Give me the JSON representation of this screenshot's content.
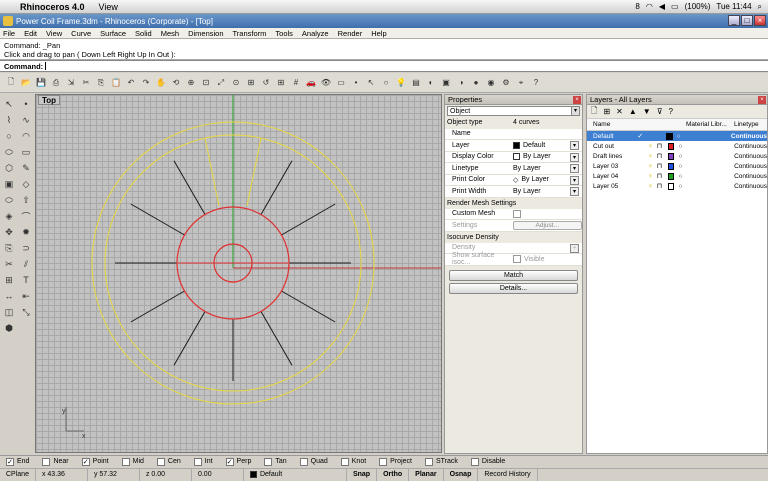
{
  "macbar": {
    "app": "Rhinoceros 4.0",
    "view_menu": "View",
    "flag": "8",
    "battery": "(100%)",
    "time": "Tue 11:44"
  },
  "window": {
    "title": "Power Coil Frame.3dm - Rhinoceros (Corporate) - [Top]"
  },
  "menu": [
    "File",
    "Edit",
    "View",
    "Curve",
    "Surface",
    "Solid",
    "Mesh",
    "Dimension",
    "Transform",
    "Tools",
    "Analyze",
    "Render",
    "Help"
  ],
  "command": {
    "history": [
      "Command: _Pan",
      "Click and drag to pan ( Down  Left  Right  Up  In  Out ):"
    ],
    "prompt": "Command:"
  },
  "toolbar_icons": [
    "new-icon",
    "open-icon",
    "save-icon",
    "print-icon",
    "import-icon",
    "cut-icon",
    "copy-icon",
    "paste-icon",
    "undo-icon",
    "redo-icon",
    "pan-icon",
    "rotate-view-icon",
    "zoom-dynamic-icon",
    "zoom-window-icon",
    "zoom-extents-icon",
    "zoom-selected-icon",
    "zoom-extents-all-icon",
    "undo-view-icon",
    "four-viewports-icon",
    "grid-snap-icon",
    "car-icon",
    "eye-icon",
    "plane-icon",
    "point-icon",
    "select-icon",
    "circle-icon",
    "light-icon",
    "layer-icon",
    "render-icon",
    "hide-icon",
    "shade-icon",
    "rendered-icon",
    "sphere-icon",
    "properties-icon",
    "osnap-icon",
    "help-icon"
  ],
  "left_tools": [
    "select-arrow-icon",
    "point-tool-icon",
    "polyline-icon",
    "curve-icon",
    "circle-tool-icon",
    "arc-icon",
    "ellipse-icon",
    "rectangle-icon",
    "polygon-icon",
    "freeform-icon",
    "box-icon",
    "surface-icon",
    "cylinder-icon",
    "extrude-icon",
    "boolean-icon",
    "fillet-icon",
    "move-icon",
    "explode-icon",
    "copy-tool-icon",
    "join-icon",
    "trim-icon",
    "split-icon",
    "array-icon",
    "text-icon",
    "dimension-icon",
    "align-icon",
    "mirror-icon",
    "scale-icon",
    "solid-icon"
  ],
  "viewport": {
    "label": "Top",
    "axis_x": "x",
    "axis_y": "y"
  },
  "properties": {
    "header": "Properties",
    "dropdown": "Object",
    "object_type_label": "Object type",
    "object_type_value": "4 curves",
    "rows": [
      {
        "k": "Name",
        "v": ""
      },
      {
        "k": "Layer",
        "v": "Default"
      },
      {
        "k": "Display Color",
        "v": "By Layer"
      },
      {
        "k": "Linetype",
        "v": "By Layer"
      },
      {
        "k": "Print Color",
        "v": "By Layer"
      },
      {
        "k": "Print Width",
        "v": "By Layer"
      }
    ],
    "render_mesh_header": "Render Mesh Settings",
    "custom_mesh_label": "Custom Mesh",
    "settings_label": "Settings",
    "adjust_label": "Adjust...",
    "isocurve_header": "Isocurve Density",
    "density_label": "Density",
    "show_surface_label": "Show surface isoc...",
    "visible_label": "Visible",
    "match_button": "Match",
    "details_button": "Details..."
  },
  "layers": {
    "header": "Layers - All Layers",
    "col_name": "Name",
    "col_material": "Material Libr...",
    "col_linetype": "Linetype",
    "rows": [
      {
        "name": "Default",
        "check": "✓",
        "color": "#000000",
        "linetype": "Continuous"
      },
      {
        "name": "Cut out",
        "check": "",
        "color": "#e02020",
        "linetype": "Continuous"
      },
      {
        "name": "Draft lines",
        "check": "",
        "color": "#8040c0",
        "linetype": "Continuous"
      },
      {
        "name": "Layer 03",
        "check": "",
        "color": "#2050e0",
        "linetype": "Continuous"
      },
      {
        "name": "Layer 04",
        "check": "",
        "color": "#20a020",
        "linetype": "Continuous"
      },
      {
        "name": "Layer 05",
        "check": "",
        "color": "#ffffff",
        "linetype": "Continuous"
      }
    ]
  },
  "osnap": [
    {
      "label": "End",
      "checked": true
    },
    {
      "label": "Near",
      "checked": false
    },
    {
      "label": "Point",
      "checked": true
    },
    {
      "label": "Mid",
      "checked": false
    },
    {
      "label": "Cen",
      "checked": false
    },
    {
      "label": "Int",
      "checked": false
    },
    {
      "label": "Perp",
      "checked": true
    },
    {
      "label": "Tan",
      "checked": false
    },
    {
      "label": "Quad",
      "checked": false
    },
    {
      "label": "Knot",
      "checked": false
    },
    {
      "label": "Project",
      "checked": false
    },
    {
      "label": "STrack",
      "checked": false
    },
    {
      "label": "Disable",
      "checked": false
    }
  ],
  "status": {
    "cplane": "CPlane",
    "x": "x 43.36",
    "y": "y 57.32",
    "z": "z 0.00",
    "dist": "0.00",
    "layer": "Default",
    "snap": "Snap",
    "ortho": "Ortho",
    "planar": "Planar",
    "osnap": "Osnap",
    "history": "Record History"
  },
  "colors": {
    "yellow_curve": "#e8d840",
    "red_curve": "#e03030",
    "black_line": "#1a1a1a",
    "x_axis": "#c03030",
    "y_axis": "#20a020"
  }
}
